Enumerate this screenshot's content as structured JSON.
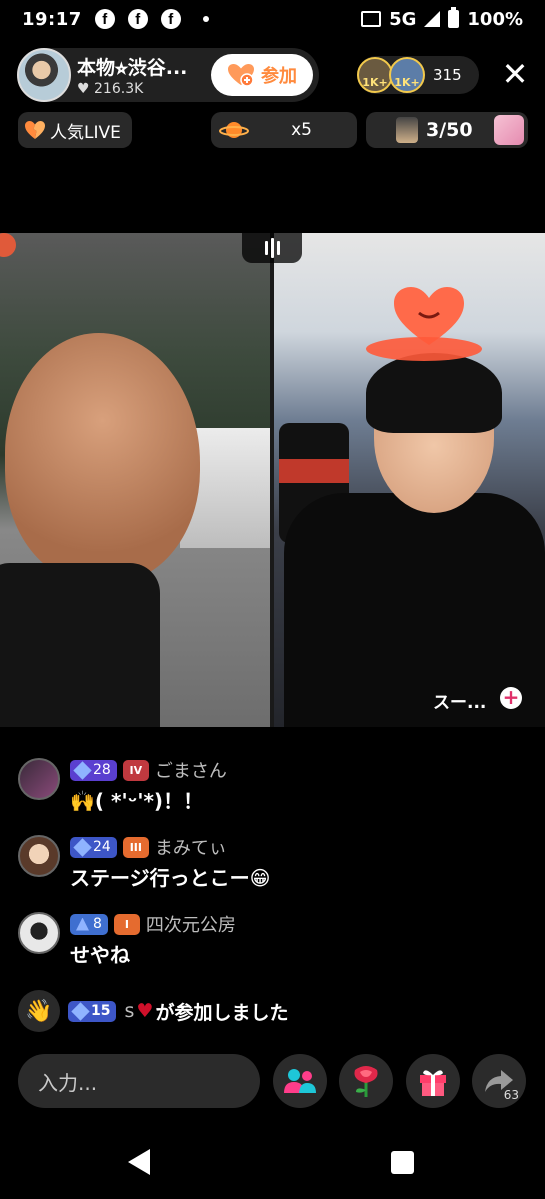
{
  "status_bar": {
    "time": "19:17",
    "network": "5G",
    "battery": "100%"
  },
  "host": {
    "name": "本物⭐︎渋谷...",
    "likes": "216.3K",
    "join_label": "参加"
  },
  "viewers": {
    "badge1": "1K+",
    "badge2": "1K+",
    "count": "315"
  },
  "chips": {
    "popular": "人気LIVE",
    "boost": "x5",
    "stage_count": "3/50"
  },
  "stage": {
    "guest_label": "スー..."
  },
  "comments": [
    {
      "level": "28",
      "rank": "IV",
      "name": "ごまさん",
      "text": "🙌( *'ᵕ'*)！！"
    },
    {
      "level": "24",
      "rank": "III",
      "name": "まみてぃ",
      "text": "ステージ行っとこー😁"
    },
    {
      "level": "8",
      "rank": "I",
      "name": "四次元公房",
      "text": "せやね"
    }
  ],
  "join_event": {
    "level": "15",
    "user": "s",
    "text": "が参加しました"
  },
  "bottom": {
    "input_placeholder": "入力...",
    "share_count": "63"
  },
  "colors": {
    "accent_orange": "#ff8a3d",
    "level_blue": "#3d56c7",
    "rank_red": "#c0393f",
    "bg": "#000000"
  }
}
